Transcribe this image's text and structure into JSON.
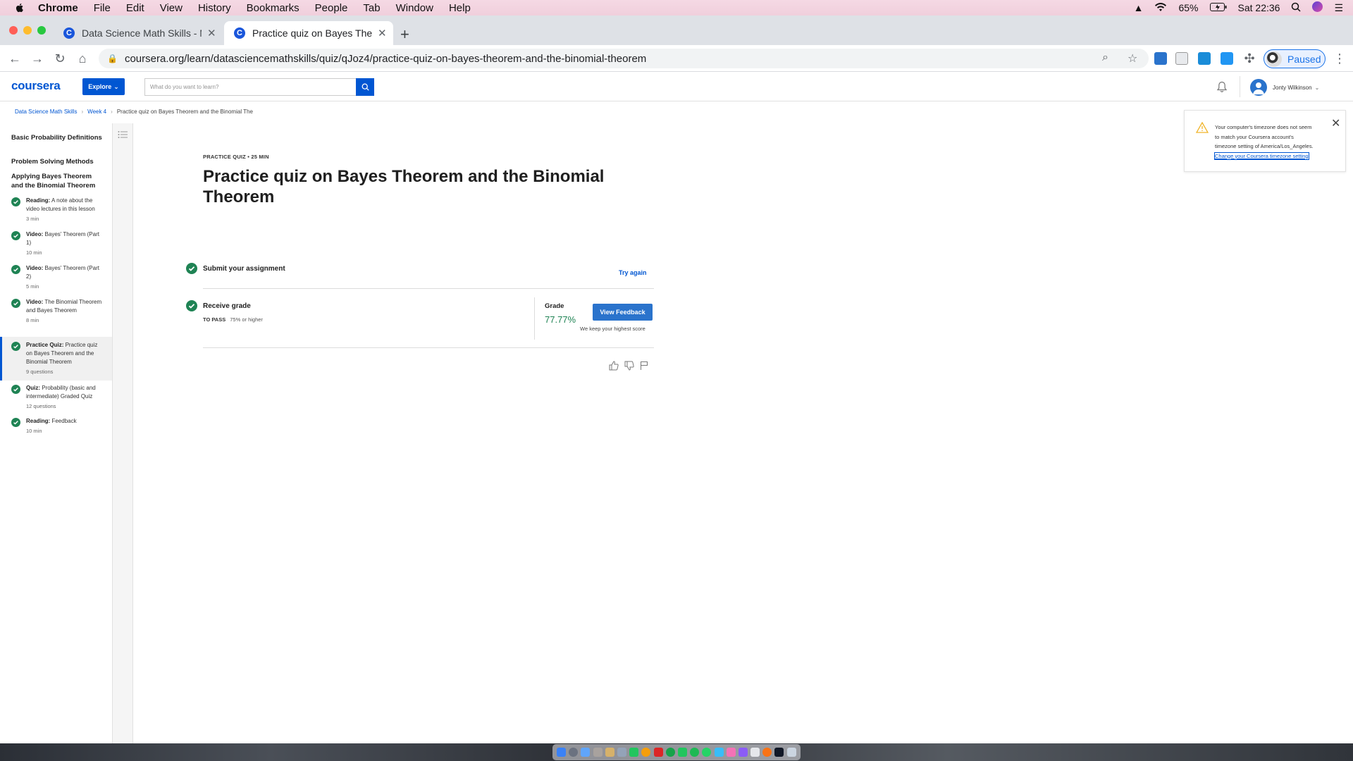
{
  "menubar": {
    "app": "Chrome",
    "items": [
      "File",
      "Edit",
      "View",
      "History",
      "Bookmarks",
      "People",
      "Tab",
      "Window",
      "Help"
    ],
    "battery": "65%",
    "clock": "Sat 22:36"
  },
  "tabs": [
    {
      "title": "Data Science Math Skills - Mea",
      "active": false
    },
    {
      "title": "Practice quiz on Bayes Theorem",
      "active": true
    }
  ],
  "toolbar": {
    "url": "coursera.org/learn/datasciencemathskills/quiz/qJoz4/practice-quiz-on-bayes-theorem-and-the-binomial-theorem",
    "profile_label": "Paused"
  },
  "header": {
    "logo": "coursera",
    "explore_label": "Explore",
    "search_placeholder": "What do you want to learn?",
    "user_name": "Jonty Wilkinson"
  },
  "breadcrumb": [
    "Data Science Math Skills",
    "Week 4",
    "Practice quiz on Bayes Theorem and the Binomial The"
  ],
  "sidebar": {
    "sections": [
      "Basic Probability Definitions",
      "Problem Solving Methods",
      "Applying Bayes Theorem and the Binomial Theorem"
    ],
    "items": [
      {
        "type": "Reading:",
        "title": "A note about the video lectures in this lesson",
        "meta": "3 min"
      },
      {
        "type": "Video:",
        "title": "Bayes' Theorem (Part 1)",
        "meta": "10 min"
      },
      {
        "type": "Video:",
        "title": "Bayes' Theorem (Part 2)",
        "meta": "5 min"
      },
      {
        "type": "Video:",
        "title": "The Binomial Theorem and Bayes Theorem",
        "meta": "8 min"
      },
      {
        "type": "Practice Quiz:",
        "title": "Practice quiz on Bayes Theorem and the Binomial Theorem",
        "meta": "9 questions"
      },
      {
        "type": "Quiz:",
        "title": "Probability (basic and intermediate) Graded Quiz",
        "meta": "12 questions"
      },
      {
        "type": "Reading:",
        "title": "Feedback",
        "meta": "10 min"
      }
    ]
  },
  "main": {
    "kicker": "PRACTICE QUIZ • 25 MIN",
    "title": "Practice quiz on Bayes Theorem and the Binomial Theorem",
    "submit_label": "Submit your assignment",
    "try_again": "Try again",
    "receive_label": "Receive grade",
    "to_pass_label": "TO PASS",
    "to_pass_value": "75% or higher",
    "grade_label": "Grade",
    "grade_value": "77.77%",
    "view_feedback": "View Feedback",
    "keep_note": "We keep your highest score"
  },
  "notification": {
    "message": "Your computer's timezone does not seem to match your Coursera account's timezone setting of America/Los_Angeles.",
    "link": "Change your Coursera timezone setting"
  },
  "colors": {
    "brand": "#0056d2",
    "success": "#1f8354",
    "check": "#1f8354"
  }
}
